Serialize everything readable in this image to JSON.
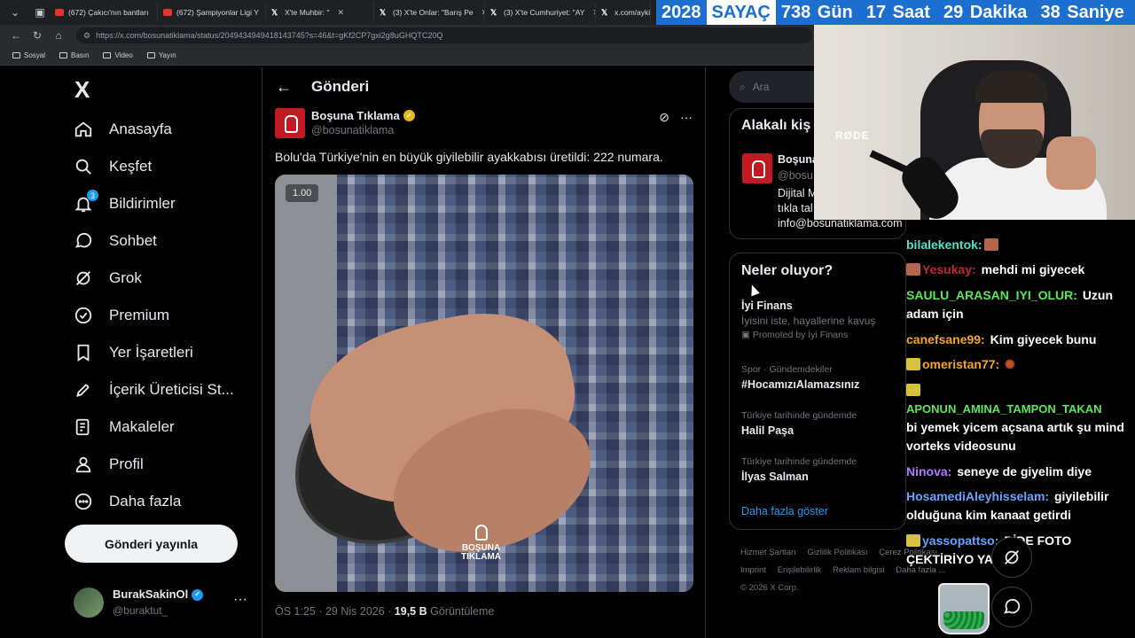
{
  "browser": {
    "tabs": [
      {
        "label": "(672) Çakıcı'nın bantları",
        "favicon": "youtube-icon"
      },
      {
        "label": "(672) Şampiyonlar Ligi Y",
        "favicon": "youtube-icon"
      },
      {
        "label": "X'te Muhbir: \"",
        "favicon": "x-icon"
      },
      {
        "label": "(3) X'te Onlar: \"Barış Pe",
        "favicon": "x-icon"
      },
      {
        "label": "(3) X'te Cumhuriyet: \"AY",
        "favicon": "x-icon"
      },
      {
        "label": "x.com/aykiri",
        "favicon": "x-icon"
      }
    ],
    "url": "https://x.com/bosunatiklama/status/2049434949418143745?s=46&t=gKf2CP7gxi2g8uGHQTC20Q",
    "bookmarks": [
      "Sosyal",
      "Basın",
      "Video",
      "Yayın"
    ]
  },
  "counter": {
    "year": "2028",
    "label": "SAYAÇ",
    "rest": "738 Gün  17 Saat  29 Dakika  38 Saniye"
  },
  "sidebar": {
    "logo": "X",
    "items": [
      {
        "label": "Anasayfa",
        "icon": "home-icon"
      },
      {
        "label": "Keşfet",
        "icon": "search-icon"
      },
      {
        "label": "Bildirimler",
        "icon": "bell-icon",
        "badge": "3"
      },
      {
        "label": "Sohbet",
        "icon": "chat-icon"
      },
      {
        "label": "Grok",
        "icon": "grok-icon"
      },
      {
        "label": "Premium",
        "icon": "premium-icon"
      },
      {
        "label": "Yer İşaretleri",
        "icon": "bookmark-icon"
      },
      {
        "label": "İçerik Üreticisi St...",
        "icon": "rocket-icon"
      },
      {
        "label": "Makaleler",
        "icon": "article-icon"
      },
      {
        "label": "Profil",
        "icon": "profile-icon"
      },
      {
        "label": "Daha fazla",
        "icon": "more-icon"
      }
    ],
    "post_button": "Gönderi yayınla",
    "account": {
      "display_name": "BurakSakinOl",
      "handle": "@buraktut_"
    }
  },
  "main": {
    "header_title": "Gönderi",
    "tweet": {
      "display_name": "Boşuna Tıklama",
      "handle": "@bosunatiklama",
      "text": "Bolu'da Türkiye'nin en büyük giyilebilir ayakkabısı üretildi: 222 numara.",
      "video_speed": "1.00",
      "watermark_line1": "BOŞUNA",
      "watermark_line2": "TIKLAMA",
      "time": "ÖS 1:25 · 29 Nis 2026 · ",
      "views": "19,5 B",
      "views_label": " Görüntüleme"
    }
  },
  "right": {
    "search_placeholder": "Ara",
    "related_title": "Alakalı kiş",
    "related_name": "Boşuna",
    "related_handle": "@bosu",
    "related_bio1": "Dijital M",
    "related_bio2": "tıkla tal",
    "related_email": "info@bosunatiklama.com",
    "trends_title": "Neler oluyor?",
    "trends": [
      {
        "context": "",
        "name": "İyi Finans",
        "sub": "İyisini iste, hayallerine kavuş",
        "promo": "Promoted by İyi Finans"
      },
      {
        "context": "Spor · Gündemdekiler",
        "name": "#HocamızıAlamazsınız"
      },
      {
        "context": "Türkiye tarihinde gündemde",
        "name": "Halil Paşa"
      },
      {
        "context": "Türkiye tarihinde gündemde",
        "name": "İlyas Salman"
      }
    ],
    "show_more": "Daha fazla göster",
    "footer": [
      "Hizmet Şartları",
      "Gizlilik Politikası",
      "Çerez Politikası",
      "Imprint",
      "Erişilebilirlik",
      "Reklam bilgisi",
      "Daha fazla ...",
      "© 2026 X Corp."
    ]
  },
  "webcam": {
    "mic_brand": "RØDE"
  },
  "chat": [
    {
      "user": "bilalekentok:",
      "color": "#4fe3c8",
      "text": ""
    },
    {
      "user": "Yesukay:",
      "color": "#c0282d",
      "text": "mehdi mi giyecek"
    },
    {
      "user": "SAULU_ARASAN_IYI_OLUR:",
      "color": "#5ce65c",
      "text": "Uzun adam için"
    },
    {
      "user": "canefsane99:",
      "color": "#f5a623",
      "text": "Kim giyecek bunu"
    },
    {
      "user": "omeristan77:",
      "color": "#f5a623",
      "text": ""
    },
    {
      "user": "APONUN_AMINA_TAMPON_TAKAN",
      "color": "#5ce65c",
      "text": "bi yemek yicem açsana artık şu mind vorteks videosunu"
    },
    {
      "user": "Ninova:",
      "color": "#b07cff",
      "text": "seneye de giyelim diye"
    },
    {
      "user": "HosamediAleyhisselam:",
      "color": "#66a3ff",
      "text": "giyilebilir olduğuna kim kanaat getirdi"
    },
    {
      "user": "yassopattso:",
      "color": "#66a3ff",
      "text": "BİDE FOTO ÇEKTİRİYO YA"
    }
  ]
}
